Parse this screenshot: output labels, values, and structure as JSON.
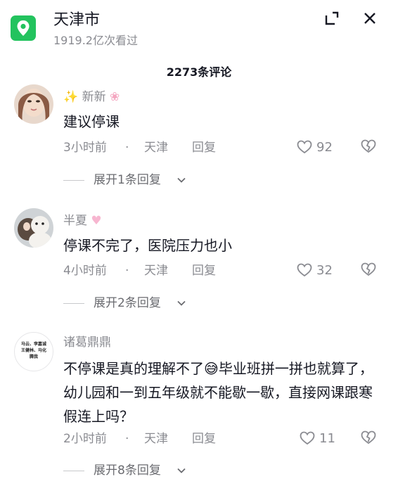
{
  "header": {
    "title": "天津市",
    "views": "1919.2亿次看过"
  },
  "comments_count": "2273条评论",
  "comments": [
    {
      "username": "新新",
      "text": "建议停课",
      "time": "3小时前",
      "dot": "·",
      "location": "天津",
      "reply": "回复",
      "likes": "92",
      "expand": "展开1条回复"
    },
    {
      "username": "半夏",
      "text": "停课不完了，医院压力也小",
      "time": "4小时前",
      "dot": "·",
      "location": "天津",
      "reply": "回复",
      "likes": "32",
      "expand": "展开2条回复"
    },
    {
      "username": "诸葛鼎鼎",
      "text": "不停课是真的理解不了😅毕业班拼一拼也就算了，幼儿园和一到五年级就不能歇一歇，直接网课跟寒假连上吗？",
      "time": "2小时前",
      "dot": "·",
      "location": "天津",
      "reply": "回复",
      "likes": "11",
      "expand": "展开8条回复",
      "avatar_text": "马云、李嘉诚王健林、马化腾我"
    }
  ],
  "colors": {
    "accent_green": "#23c35e",
    "text_primary": "#161823",
    "text_secondary": "#8a8b91"
  }
}
